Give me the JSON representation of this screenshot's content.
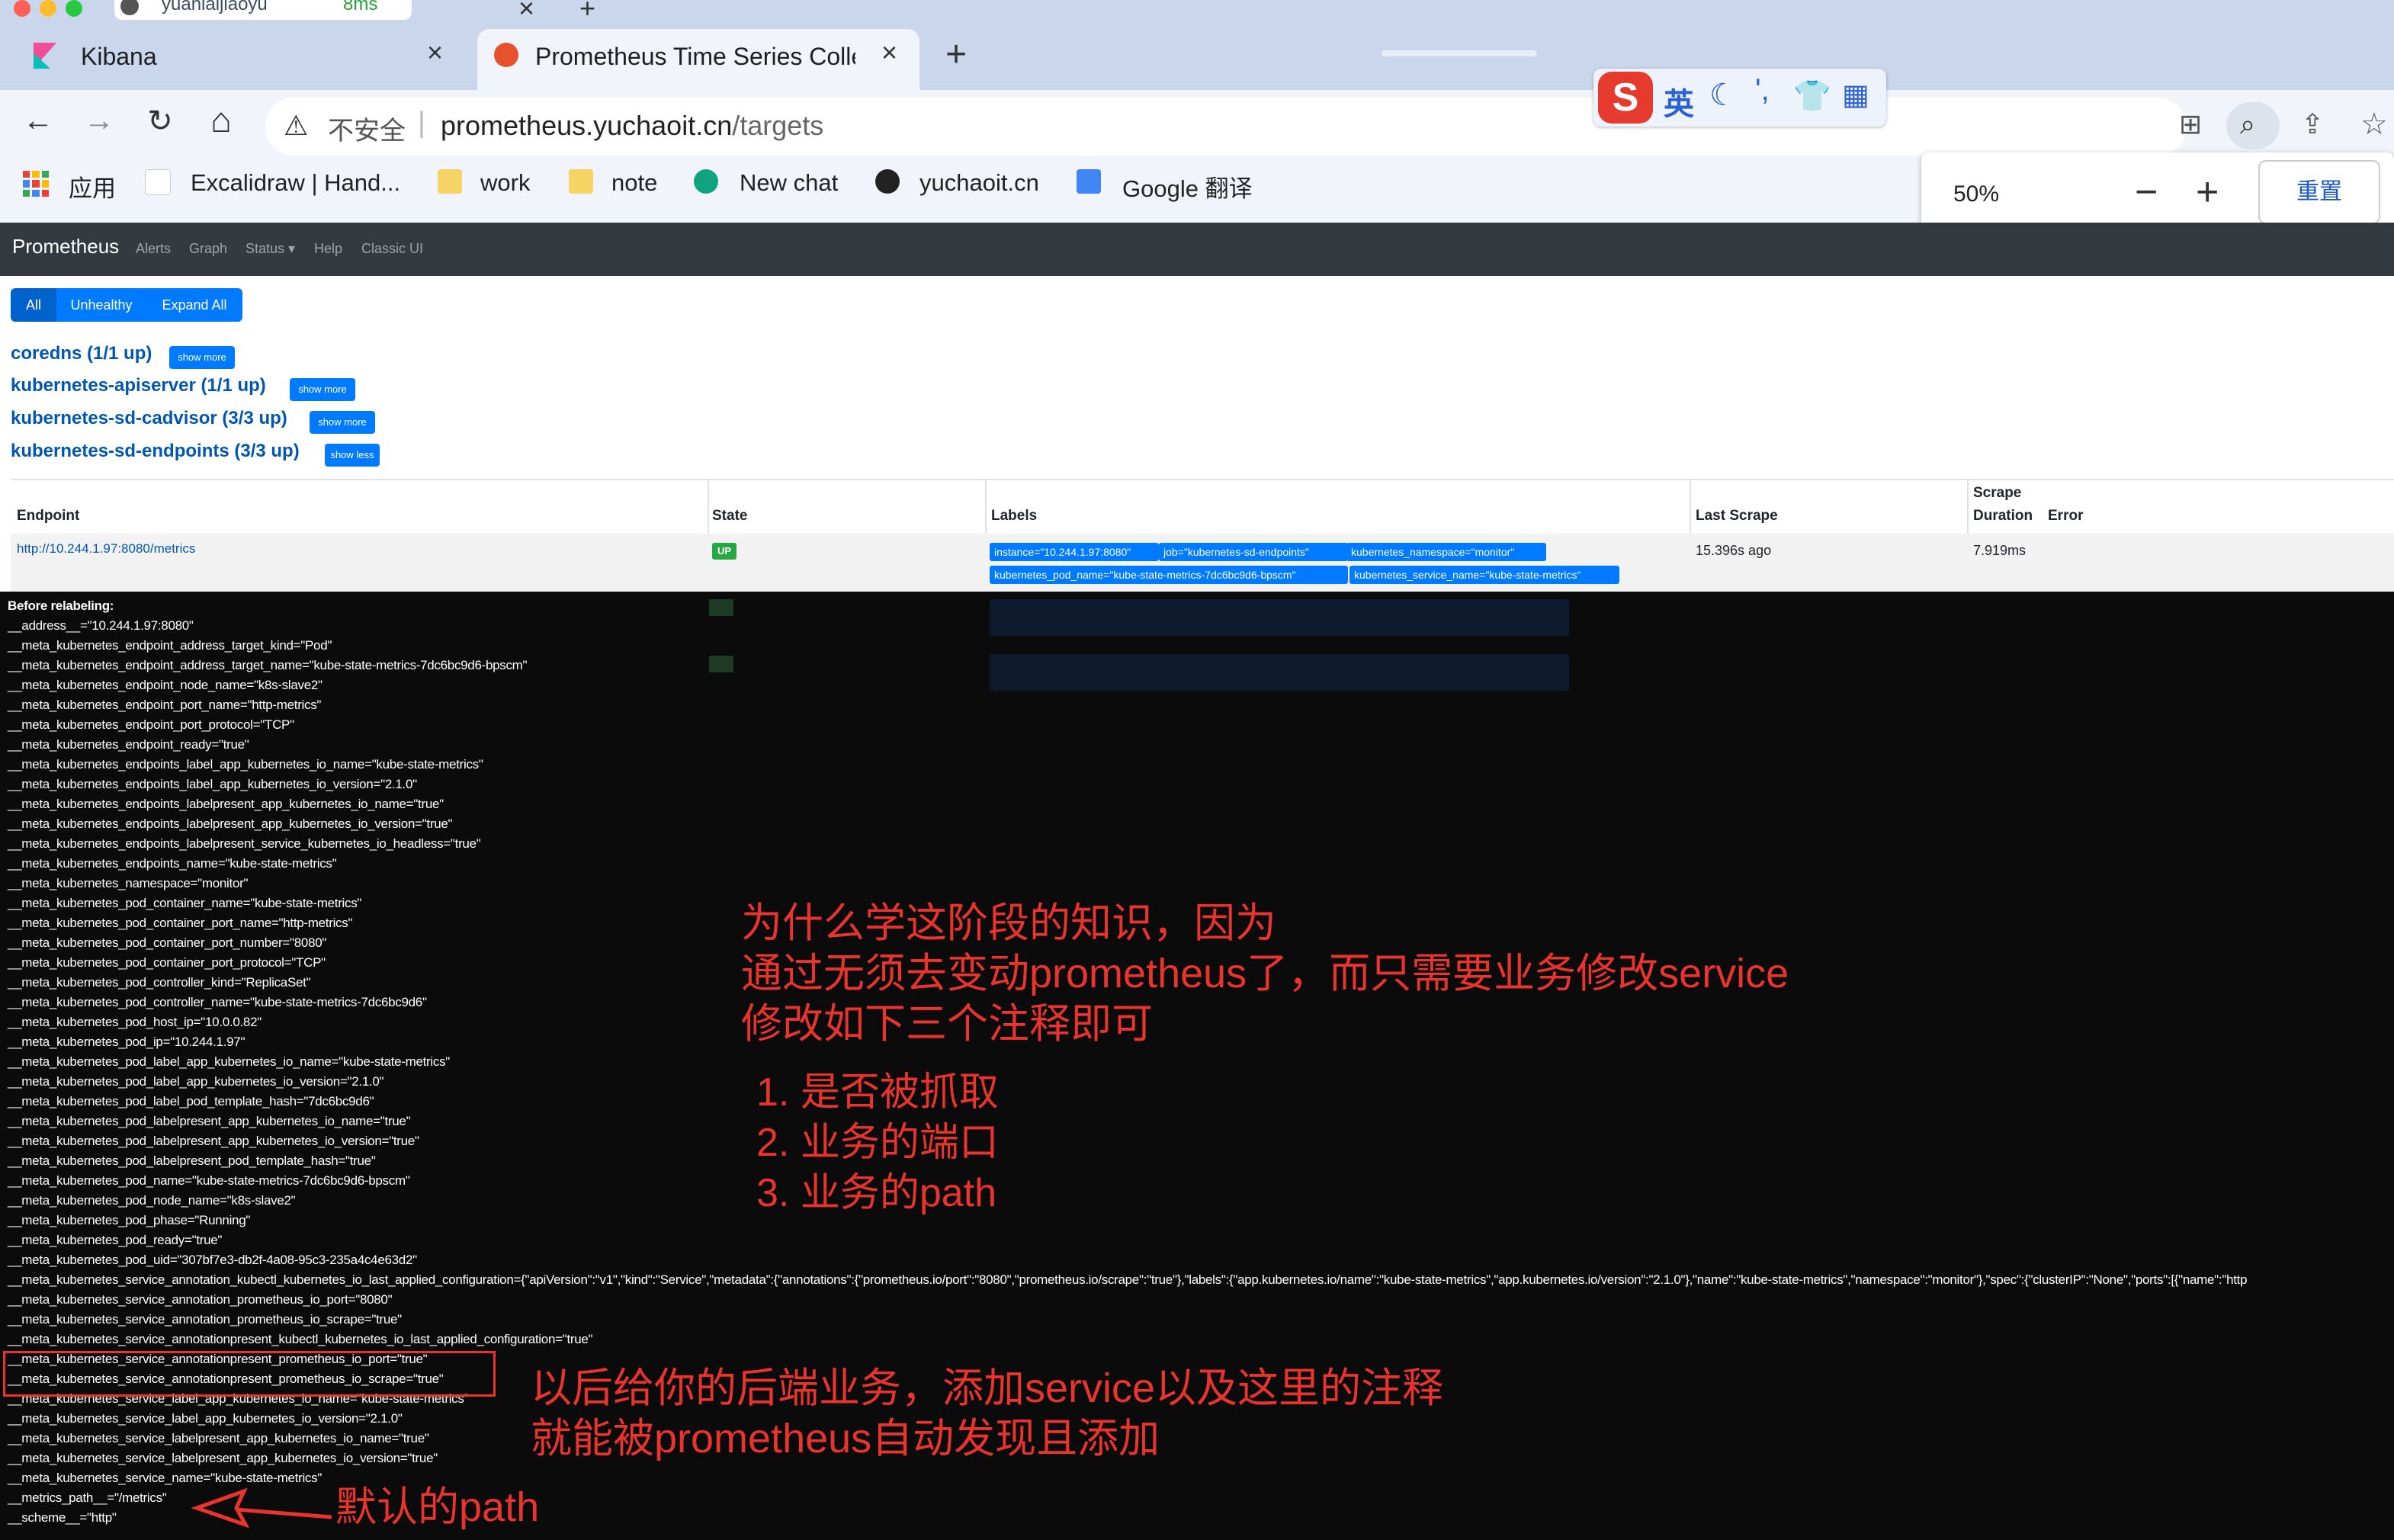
{
  "os_strip": {
    "tab_text": "yuanlaijiaoyu",
    "ping": "8ms"
  },
  "tabs": [
    {
      "title": "Kibana",
      "close": "×"
    },
    {
      "title": "Prometheus Time Series Colle",
      "close": "×"
    }
  ],
  "new_tab": "+",
  "toolbar": {
    "security": "不安全",
    "url_host": "prometheus.yuchaoit.cn",
    "url_path": "/targets",
    "back": "←",
    "forward": "→",
    "reload": "↻",
    "home": "⌂"
  },
  "bookmarks": [
    "应用",
    "Excalidraw | Hand...",
    "work",
    "note",
    "New chat",
    "yuchaoit.cn",
    "Google 翻译"
  ],
  "zoom_popup": {
    "level": "50%",
    "minus": "−",
    "plus": "+",
    "reset": "重置"
  },
  "sogou": {
    "mode": "英"
  },
  "prometheus_nav": {
    "brand": "Prometheus",
    "items": [
      "Alerts",
      "Graph",
      "Status ▾",
      "Help",
      "Classic UI"
    ]
  },
  "filter_buttons": [
    "All",
    "Unhealthy",
    "Expand All"
  ],
  "jobs": [
    {
      "name": "coredns (1/1 up)",
      "button": "show more"
    },
    {
      "name": "kubernetes-apiserver (1/1 up)",
      "button": "show more"
    },
    {
      "name": "kubernetes-sd-cadvisor (3/3 up)",
      "button": "show more"
    },
    {
      "name": "kubernetes-sd-endpoints (3/3 up)",
      "button": "show less"
    }
  ],
  "table": {
    "headers": [
      "Endpoint",
      "State",
      "Labels",
      "Last Scrape",
      "Scrape",
      "Duration",
      "Error"
    ],
    "row": {
      "endpoint": "http://10.244.1.97:8080/metrics",
      "state": "UP",
      "labels": [
        "instance=\"10.244.1.97:8080\"",
        "job=\"kubernetes-sd-endpoints\"",
        "kubernetes_namespace=\"monitor\"",
        "kubernetes_pod_name=\"kube-state-metrics-7dc6bc9d6-bpscm\"",
        "kubernetes_service_name=\"kube-state-metrics\""
      ],
      "last_scrape": "15.396s ago",
      "duration": "7.919ms"
    }
  },
  "relabel": {
    "title": "Before relabeling:",
    "lines": [
      "__address__=\"10.244.1.97:8080\"",
      "__meta_kubernetes_endpoint_address_target_kind=\"Pod\"",
      "__meta_kubernetes_endpoint_address_target_name=\"kube-state-metrics-7dc6bc9d6-bpscm\"",
      "__meta_kubernetes_endpoint_node_name=\"k8s-slave2\"",
      "__meta_kubernetes_endpoint_port_name=\"http-metrics\"",
      "__meta_kubernetes_endpoint_port_protocol=\"TCP\"",
      "__meta_kubernetes_endpoint_ready=\"true\"",
      "__meta_kubernetes_endpoints_label_app_kubernetes_io_name=\"kube-state-metrics\"",
      "__meta_kubernetes_endpoints_label_app_kubernetes_io_version=\"2.1.0\"",
      "__meta_kubernetes_endpoints_labelpresent_app_kubernetes_io_name=\"true\"",
      "__meta_kubernetes_endpoints_labelpresent_app_kubernetes_io_version=\"true\"",
      "__meta_kubernetes_endpoints_labelpresent_service_kubernetes_io_headless=\"true\"",
      "__meta_kubernetes_endpoints_name=\"kube-state-metrics\"",
      "__meta_kubernetes_namespace=\"monitor\"",
      "__meta_kubernetes_pod_container_name=\"kube-state-metrics\"",
      "__meta_kubernetes_pod_container_port_name=\"http-metrics\"",
      "__meta_kubernetes_pod_container_port_number=\"8080\"",
      "__meta_kubernetes_pod_container_port_protocol=\"TCP\"",
      "__meta_kubernetes_pod_controller_kind=\"ReplicaSet\"",
      "__meta_kubernetes_pod_controller_name=\"kube-state-metrics-7dc6bc9d6\"",
      "__meta_kubernetes_pod_host_ip=\"10.0.0.82\"",
      "__meta_kubernetes_pod_ip=\"10.244.1.97\"",
      "__meta_kubernetes_pod_label_app_kubernetes_io_name=\"kube-state-metrics\"",
      "__meta_kubernetes_pod_label_app_kubernetes_io_version=\"2.1.0\"",
      "__meta_kubernetes_pod_label_pod_template_hash=\"7dc6bc9d6\"",
      "__meta_kubernetes_pod_labelpresent_app_kubernetes_io_name=\"true\"",
      "__meta_kubernetes_pod_labelpresent_app_kubernetes_io_version=\"true\"",
      "__meta_kubernetes_pod_labelpresent_pod_template_hash=\"true\"",
      "__meta_kubernetes_pod_name=\"kube-state-metrics-7dc6bc9d6-bpscm\"",
      "__meta_kubernetes_pod_node_name=\"k8s-slave2\"",
      "__meta_kubernetes_pod_phase=\"Running\"",
      "__meta_kubernetes_pod_ready=\"true\"",
      "__meta_kubernetes_pod_uid=\"307bf7e3-db2f-4a08-95c3-235a4c4e63d2\"",
      "__meta_kubernetes_service_annotation_kubectl_kubernetes_io_last_applied_configuration={\"apiVersion\":\"v1\",\"kind\":\"Service\",\"metadata\":{\"annotations\":{\"prometheus.io/port\":\"8080\",\"prometheus.io/scrape\":\"true\"},\"labels\":{\"app.kubernetes.io/name\":\"kube-state-metrics\",\"app.kubernetes.io/version\":\"2.1.0\"},\"name\":\"kube-state-metrics\",\"namespace\":\"monitor\"},\"spec\":{\"clusterIP\":\"None\",\"ports\":[{\"name\":\"http",
      "__meta_kubernetes_service_annotation_prometheus_io_port=\"8080\"",
      "__meta_kubernetes_service_annotation_prometheus_io_scrape=\"true\"",
      "__meta_kubernetes_service_annotationpresent_kubectl_kubernetes_io_last_applied_configuration=\"true\"",
      "__meta_kubernetes_service_annotationpresent_prometheus_io_port=\"true\"",
      "__meta_kubernetes_service_annotationpresent_prometheus_io_scrape=\"true\"",
      "__meta_kubernetes_service_label_app_kubernetes_io_name=\"kube-state-metrics\"",
      "__meta_kubernetes_service_label_app_kubernetes_io_version=\"2.1.0\"",
      "__meta_kubernetes_service_labelpresent_app_kubernetes_io_name=\"true\"",
      "__meta_kubernetes_service_labelpresent_app_kubernetes_io_version=\"true\"",
      "__meta_kubernetes_service_name=\"kube-state-metrics\"",
      "__metrics_path__=\"/metrics\"",
      "__scheme__=\"http\""
    ]
  },
  "annotations": {
    "why_line1": "为什么学这阶段的知识，因为",
    "why_line2": "通过无须去变动prometheus了，而只需要业务修改service",
    "why_line3": "修改如下三个注释即可",
    "list": [
      "1. 是否被抓取",
      "2. 业务的端口",
      "3. 业务的path"
    ],
    "later_line1": "以后给你的后端业务，添加service以及这里的注释",
    "later_line2": "就能被prometheus自动发现且添加",
    "default_path": "默认的path"
  },
  "colors": {
    "accent": "#007bff",
    "annotation": "#e8342c",
    "navbar": "#343a40"
  }
}
